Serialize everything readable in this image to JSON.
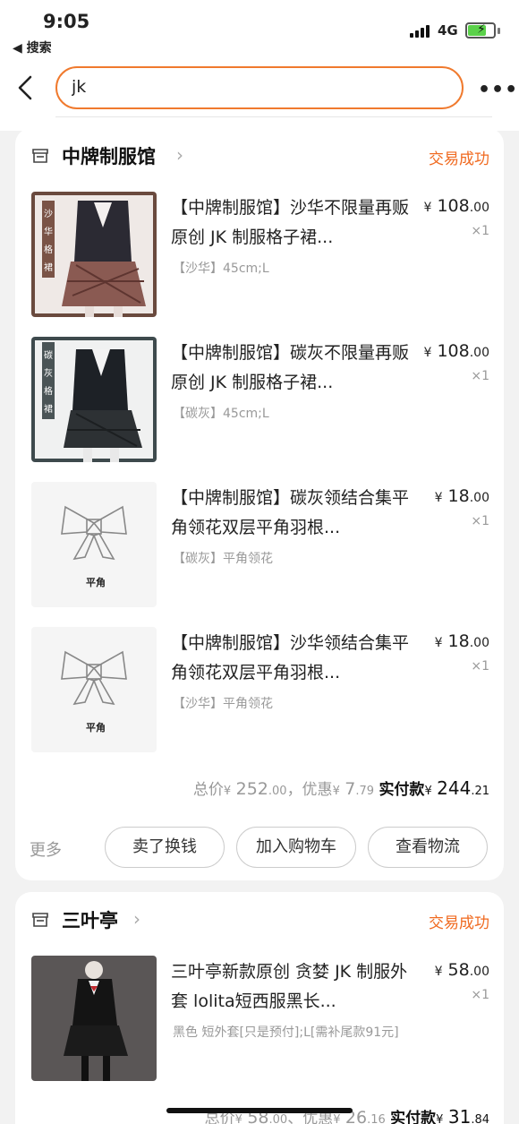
{
  "status_bar": {
    "time": "9:05",
    "back_app": "◀ 搜索",
    "network": "4G"
  },
  "nav": {
    "search_value": "jk"
  },
  "orders": [
    {
      "shop": "中牌制服馆",
      "status": "交易成功",
      "items": [
        {
          "title": "【中牌制服馆】沙华不限量再贩原创 JK 制服格子裙...",
          "sku": "【沙华】45cm;L",
          "price_int": "108",
          "price_dec": ".00",
          "qty": "×1",
          "thumb_text": [
            "沙",
            "华",
            "格",
            "裙"
          ]
        },
        {
          "title": "【中牌制服馆】碳灰不限量再贩原创 JK 制服格子裙...",
          "sku": "【碳灰】45cm;L",
          "price_int": "108",
          "price_dec": ".00",
          "qty": "×1",
          "thumb_text": [
            "碳",
            "灰",
            "格",
            "裙"
          ]
        },
        {
          "title": "【中牌制服馆】碳灰领结合集平角领花双层平角羽根...",
          "sku": "【碳灰】平角领花",
          "price_int": "18",
          "price_dec": ".00",
          "qty": "×1",
          "thumb_text": [
            "平角"
          ]
        },
        {
          "title": "【中牌制服馆】沙华领结合集平角领花双层平角羽根...",
          "sku": "【沙华】平角领花",
          "price_int": "18",
          "price_dec": ".00",
          "qty": "×1",
          "thumb_text": [
            "平角"
          ]
        }
      ],
      "summary": {
        "total_label": "总价",
        "total_int": "252",
        "total_dec": ".00",
        "discount_label": "，优惠",
        "discount_int": "7",
        "discount_dec": ".79",
        "paid_label": "实付款",
        "paid_int": "244",
        "paid_dec": ".21"
      },
      "actions": {
        "more": "更多",
        "sell": "卖了换钱",
        "add_cart": "加入购物车",
        "logistics": "查看物流"
      }
    },
    {
      "shop": "三叶亭",
      "status": "交易成功",
      "items": [
        {
          "title": "三叶亭新款原创 贪婪 JK 制服外套 lolita短西服黑长...",
          "sku": "黑色 短外套[只是预付];L[需补尾款91元]",
          "price_int": "58",
          "price_dec": ".00",
          "qty": "×1"
        }
      ],
      "summary": {
        "total_label": "总价",
        "total_int": "58",
        "total_dec": ".00",
        "discount_label": "、优惠",
        "discount_int": "26",
        "discount_dec": ".16",
        "paid_label": "实付款",
        "paid_int": "31",
        "paid_dec": ".84"
      }
    }
  ],
  "currency": "¥",
  "colors": {
    "accent": "#f07a2e",
    "status": "#f06a20",
    "page_bg": "#f2f2f2"
  },
  "icons": {
    "back": "chevron-left-icon",
    "more": "more-dots-icon",
    "shop": "shop-icon",
    "shop_chevron": "chevron-right-icon"
  }
}
